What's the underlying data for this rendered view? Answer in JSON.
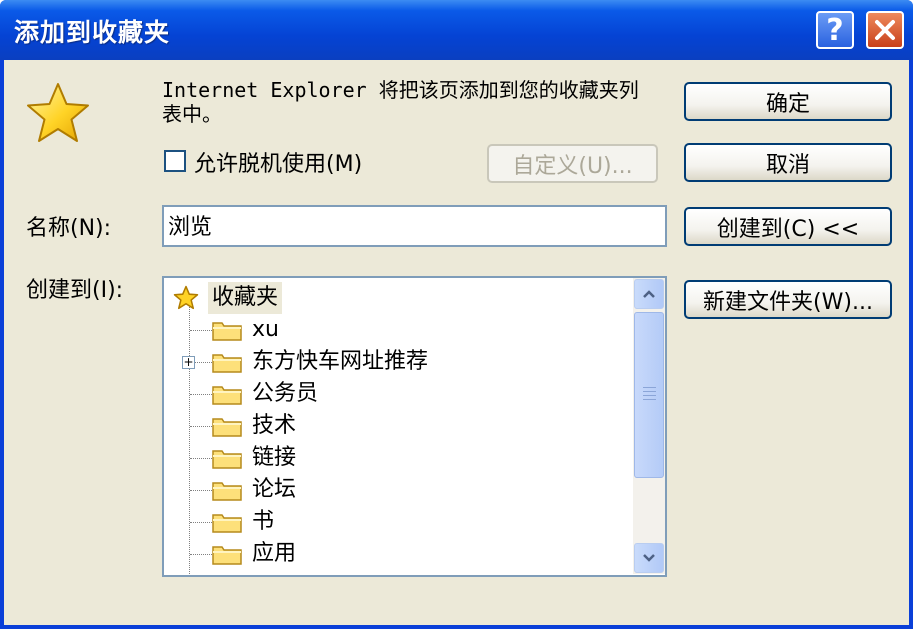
{
  "window": {
    "title": "添加到收藏夹",
    "help_label": "?",
    "close_icon": "close-icon"
  },
  "dialog": {
    "message": "Internet Explorer 将把该页添加到您的收藏夹列表中。",
    "offline_label": "允许脱机使用(M)",
    "offline_checked": false,
    "customize_label": "自定义(U)...",
    "name_label": "名称(N):",
    "name_value": "浏览",
    "create_in_label": "创建到(I):"
  },
  "buttons": {
    "ok": "确定",
    "cancel": "取消",
    "create_in": "创建到(C) <<",
    "new_folder": "新建文件夹(W)..."
  },
  "tree": {
    "root": "收藏夹",
    "items": [
      {
        "label": "xu",
        "expandable": false
      },
      {
        "label": "东方快车网址推荐",
        "expandable": true
      },
      {
        "label": "公务员",
        "expandable": false
      },
      {
        "label": "技术",
        "expandable": false
      },
      {
        "label": "链接",
        "expandable": false
      },
      {
        "label": "论坛",
        "expandable": false
      },
      {
        "label": "书",
        "expandable": false
      },
      {
        "label": "应用",
        "expandable": false
      }
    ]
  },
  "icons": {
    "star": "star-icon",
    "folder": "folder-icon",
    "scroll_up": "scroll-up-icon",
    "scroll_down": "scroll-down-icon"
  },
  "colors": {
    "title_bar": "#0a5ae8",
    "client_bg": "#ece9d8",
    "close_button": "#d6502a",
    "button_border": "#003c74"
  }
}
